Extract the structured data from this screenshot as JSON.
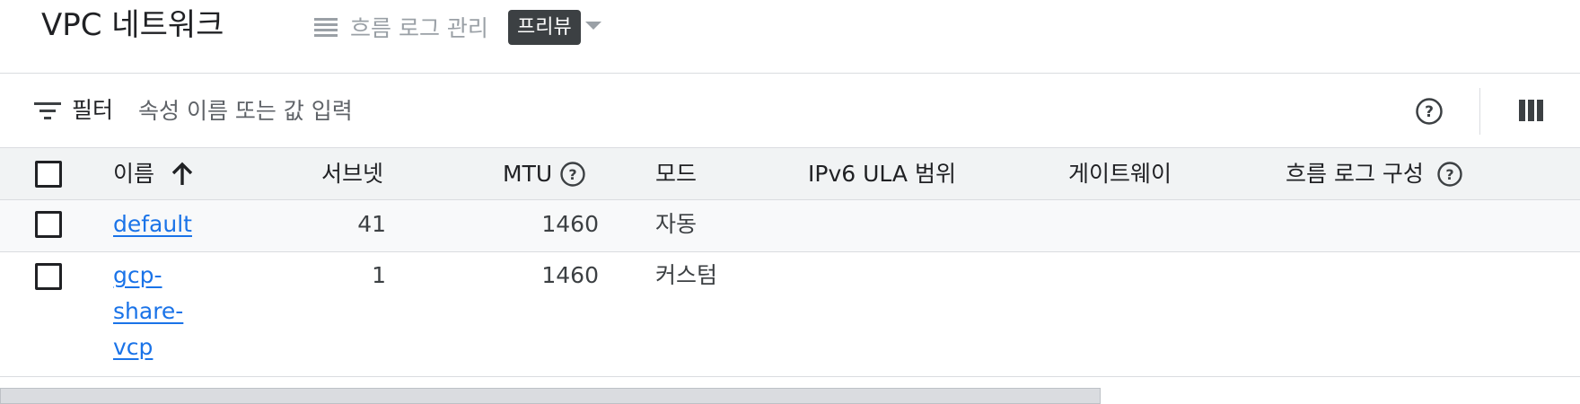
{
  "header": {
    "title": "VPC 네트워크",
    "flow_logs_label": "흐름 로그 관리",
    "preview_badge": "프리뷰"
  },
  "filter": {
    "label": "필터",
    "placeholder": "속성 이름 또는 값 입력"
  },
  "table": {
    "columns": {
      "name": "이름",
      "subnets": "서브넷",
      "mtu": "MTU",
      "mode": "모드",
      "ipv6": "IPv6 ULA 범위",
      "gateway": "게이트웨이",
      "flow_log_config": "흐름 로그 구성"
    },
    "rows": [
      {
        "name": "default",
        "subnets": "41",
        "mtu": "1460",
        "mode": "자동"
      },
      {
        "name_lines": [
          "gcp-",
          "share-",
          "vcp"
        ],
        "subnets": "1",
        "mtu": "1460",
        "mode": "커스텀"
      }
    ]
  },
  "icons": {
    "flow_logs": "list-icon",
    "filter": "filter-icon",
    "help": "help-circle-icon",
    "columns": "column-display-icon",
    "sort": "arrow-up-icon"
  },
  "colors": {
    "link": "#1a73e8",
    "badge_bg": "#3c4043",
    "header_bg": "#f1f3f4",
    "muted": "#9aa0a6"
  }
}
